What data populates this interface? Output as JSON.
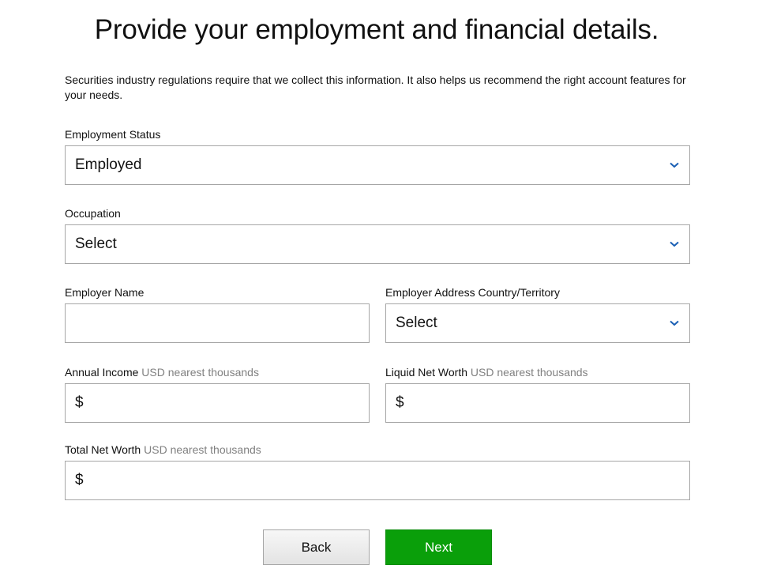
{
  "header": {
    "title": "Provide your employment and financial details."
  },
  "intro": {
    "text": "Securities industry regulations require that we collect this information. It also helps us recommend the right account features for your needs."
  },
  "form": {
    "employment_status": {
      "label": "Employment Status",
      "value": "Employed"
    },
    "occupation": {
      "label": "Occupation",
      "value": "Select"
    },
    "employer_name": {
      "label": "Employer Name",
      "value": ""
    },
    "employer_country": {
      "label": "Employer Address Country/Territory",
      "value": "Select"
    },
    "annual_income": {
      "label": "Annual Income",
      "hint": "USD nearest thousands",
      "prefix": "$",
      "value": ""
    },
    "liquid_net_worth": {
      "label": "Liquid Net Worth",
      "hint": "USD nearest thousands",
      "prefix": "$",
      "value": ""
    },
    "total_net_worth": {
      "label": "Total Net Worth",
      "hint": "USD nearest thousands",
      "prefix": "$",
      "value": ""
    }
  },
  "actions": {
    "back_label": "Back",
    "next_label": "Next"
  },
  "colors": {
    "accent_chevron": "#1a5fb4",
    "next_button": "#0a9f0a",
    "border": "#a6a6a6",
    "hint_text": "#808080"
  },
  "icons": {
    "dropdown": "chevron-down-icon"
  }
}
